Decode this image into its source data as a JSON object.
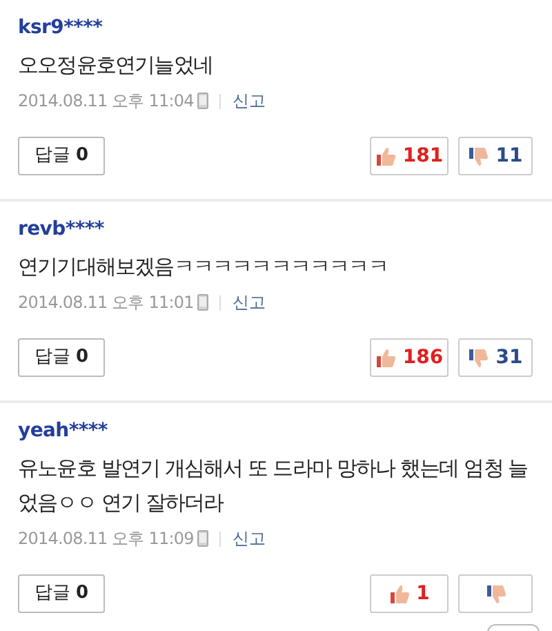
{
  "comments": [
    {
      "user": "ksr9****",
      "text": "오오정윤호연기늘었네",
      "time": "2014.08.11 오후 11:04",
      "report": "신고",
      "reply_label": "답글",
      "reply_count": "0",
      "likes": "181",
      "dislikes": "11"
    },
    {
      "user": "revb****",
      "text": "연기기대해보겠음ㅋㅋㅋㅋㅋㅋㅋㅋㅋㅋㅋ",
      "time": "2014.08.11 오후 11:01",
      "report": "신고",
      "reply_label": "답글",
      "reply_count": "0",
      "likes": "186",
      "dislikes": "31"
    },
    {
      "user": "yeah****",
      "text": "유노윤호 발연기 개심해서 또 드라마 망하나 했는데 엄청 늘었음ㅇㅇ 연기 잘하더라",
      "time": "2014.08.11 오후 11:09",
      "report": "신고",
      "reply_label": "답글",
      "reply_count": "0",
      "likes": "1"
    }
  ]
}
